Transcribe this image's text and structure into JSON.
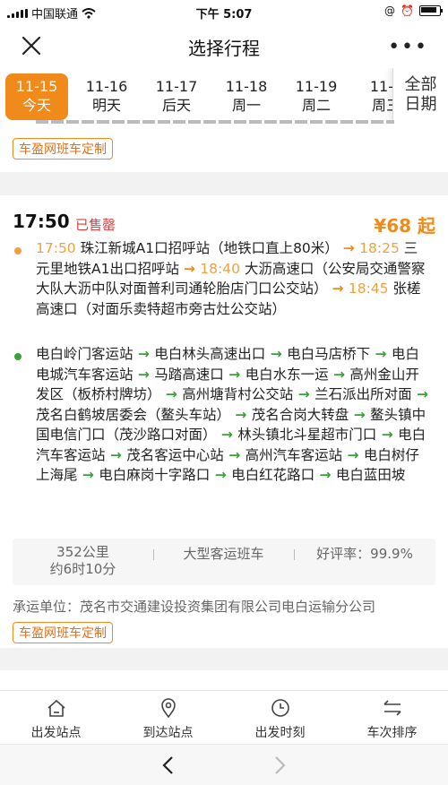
{
  "status": {
    "carrier": "中国联通",
    "time": "下午 5:07",
    "battery_icon": "battery-icon"
  },
  "nav": {
    "title": "选择行程"
  },
  "dates": [
    {
      "date": "11-15",
      "day": "今天"
    },
    {
      "date": "11-16",
      "day": "明天"
    },
    {
      "date": "11-17",
      "day": "后天"
    },
    {
      "date": "11-18",
      "day": "周一"
    },
    {
      "date": "11-19",
      "day": "周二"
    },
    {
      "date": "11-2",
      "day": "周三"
    }
  ],
  "all_dates": {
    "line1": "全部",
    "line2": "日期"
  },
  "card1": {
    "tag": "车盈网班车定制"
  },
  "card2": {
    "time": "17:50",
    "status": "已售罄",
    "price": "¥68 起",
    "boarding": {
      "s1_time": "17:50",
      "s1": "珠江新城A1口招呼站（地铁口直上80米）",
      "s2_time": "18:25",
      "s2": "三元里地铁A1出口招呼站",
      "s3_time": "18:40",
      "s3": "大沥高速口（公安局交通警察大队大沥中队对面普利司通轮胎店门口公交站）",
      "s4_time": "18:45",
      "s4": "张槎高速口（对面乐卖特超市旁古灶公交站）"
    },
    "alighting": [
      "电白岭门客运站",
      "电白林头高速出口",
      "电白马店桥下",
      "电白电城汽车客运站",
      "马踏高速口",
      "电白水东一运",
      "高州金山开发区（板桥村牌坊）",
      "高州塘背村公交站",
      "兰石派出所对面",
      "茂名白鹤坡居委会（鳌头车站）",
      "茂名合岗大转盘",
      "鳌头镇中国电信门口（茂沙路口对面）",
      "林头镇北斗星超市门口",
      "电白汽车客运站",
      "茂名客运中心站",
      "高州汽车客运站",
      "电白树仔上海尾",
      "电白麻岗十字路口",
      "电白红花路口",
      "电白蓝田坡"
    ],
    "distance": "352公里",
    "duration": "约6时10分",
    "bus_type": "大型客运班车",
    "rating": "好评率：99.9%",
    "carrier": "承运单位：茂名市交通建设投资集团有限公司电白运输分公司",
    "tag": "车盈网班车定制"
  },
  "tabs": [
    {
      "label": "出发站点",
      "icon": "home-icon"
    },
    {
      "label": "到达站点",
      "icon": "location-pin-icon"
    },
    {
      "label": "出发时刻",
      "icon": "clock-icon"
    },
    {
      "label": "车次排序",
      "icon": "swap-icon"
    }
  ],
  "colors": {
    "accent": "#f08a1a",
    "sold_out": "#e03b3b",
    "arrow_green": "#3aa03a"
  }
}
